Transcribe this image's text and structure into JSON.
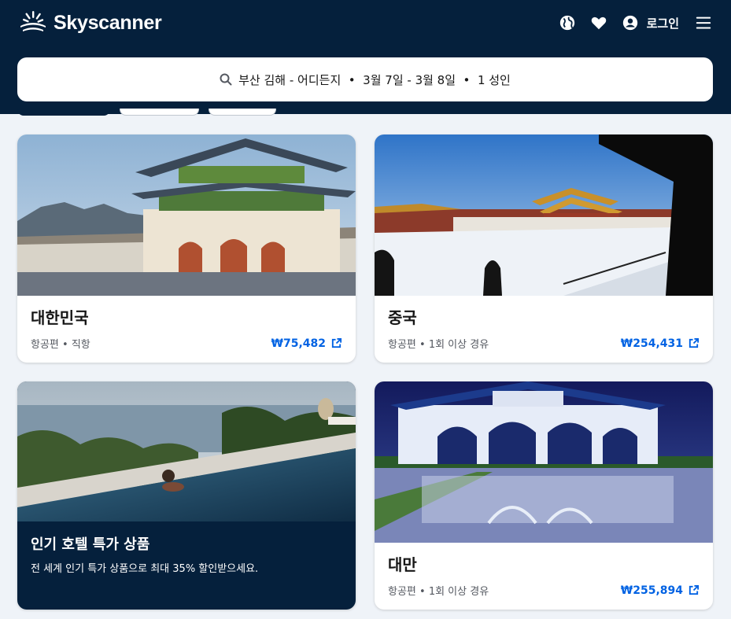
{
  "header": {
    "brand": "Skyscanner",
    "login_label": "로그인",
    "icons": [
      "globe-icon",
      "heart-icon",
      "account-icon",
      "menu-icon"
    ]
  },
  "search": {
    "summary": "부산 김해 - 어디든지  •  3월 7일 - 3월 8일  •  1 성인"
  },
  "cards": [
    {
      "title": "대한민국",
      "subtitle": "항공편 • 직항",
      "price": "₩75,482"
    },
    {
      "title": "중국",
      "subtitle": "항공편 • 1회 이상 경유",
      "price": "₩254,431"
    },
    {
      "title": "인기 호텔 특가 상품",
      "description": "전 세계 인기 특가 상품으로 최대 35% 할인받으세요."
    },
    {
      "title": "대만",
      "subtitle": "항공편 • 1회 이상 경유",
      "price": "₩255,894"
    }
  ],
  "colors": {
    "header_bg": "#05203c",
    "accent": "#0062e3",
    "page_bg": "#eff3f8"
  }
}
